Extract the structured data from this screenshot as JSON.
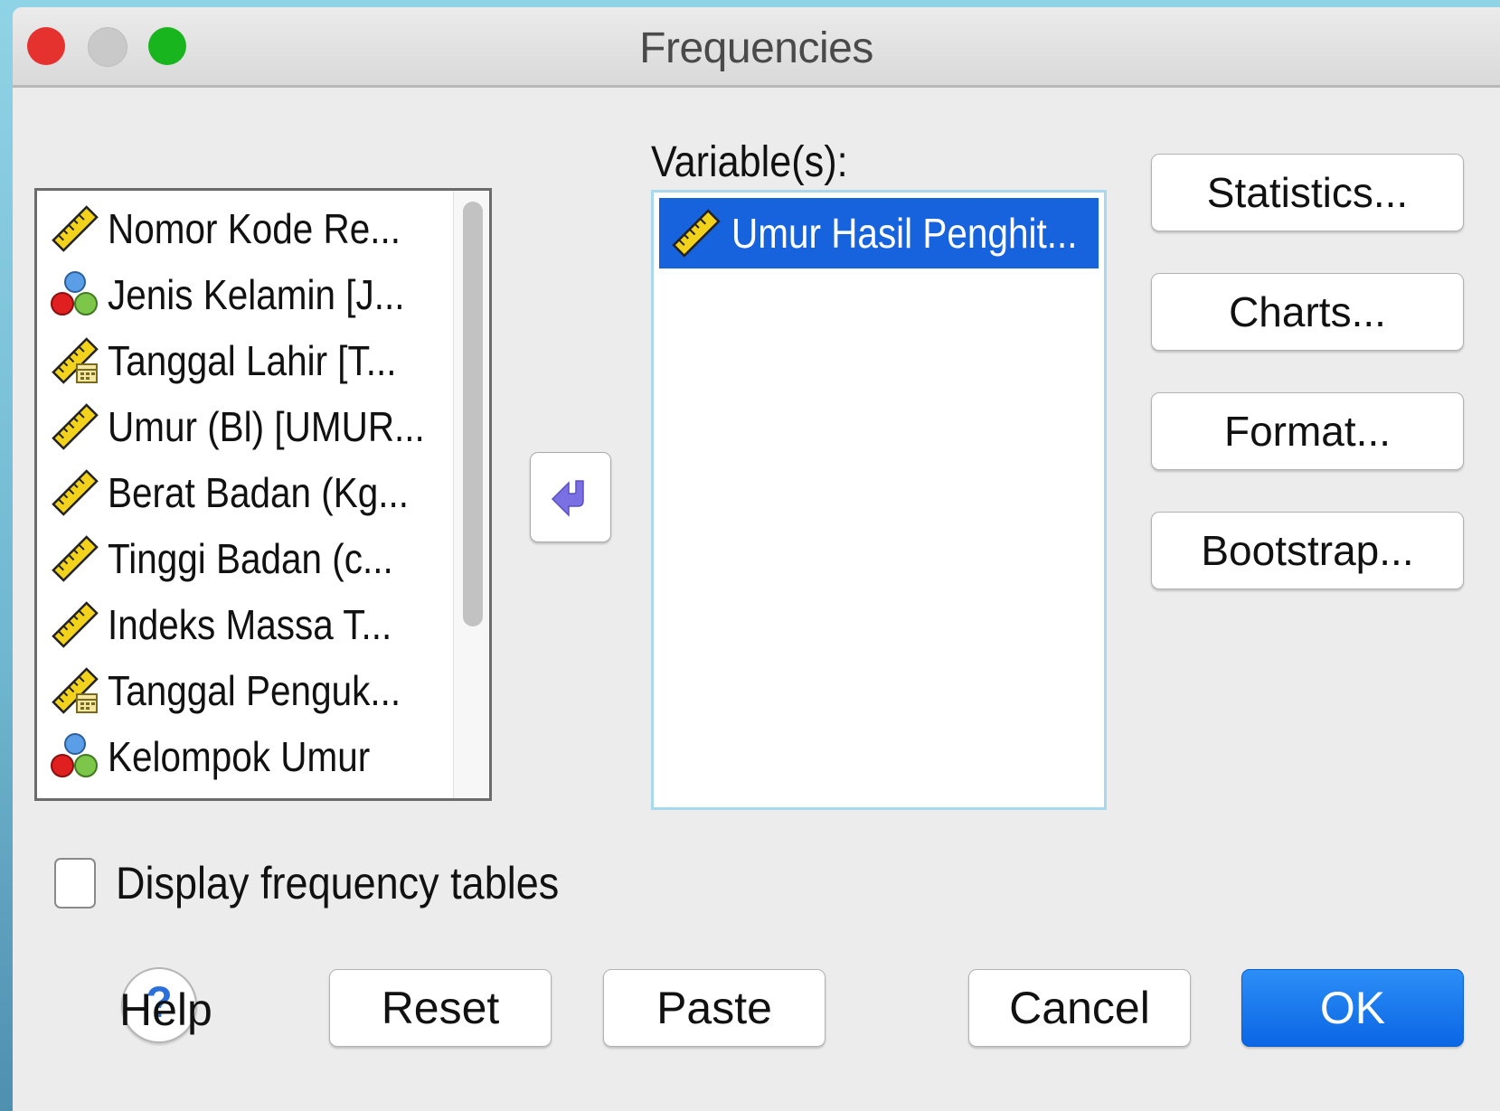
{
  "window": {
    "title": "Frequencies"
  },
  "source_list": {
    "items": [
      {
        "label": "Nomor Kode Re...",
        "icon": "scale-ruler-icon"
      },
      {
        "label": "Jenis Kelamin [J...",
        "icon": "nominal-icon"
      },
      {
        "label": "Tanggal Lahir [T...",
        "icon": "date-scale-icon"
      },
      {
        "label": "Umur (Bl) [UMUR...",
        "icon": "scale-ruler-icon"
      },
      {
        "label": "Berat Badan (Kg...",
        "icon": "scale-ruler-icon"
      },
      {
        "label": "Tinggi Badan (c...",
        "icon": "scale-ruler-icon"
      },
      {
        "label": "Indeks Massa T...",
        "icon": "scale-ruler-icon"
      },
      {
        "label": "Tanggal Penguk...",
        "icon": "date-scale-icon"
      },
      {
        "label": "Kelompok Umur",
        "icon": "nominal-icon"
      }
    ]
  },
  "move_button": {
    "icon": "arrow-left-icon"
  },
  "variables": {
    "label": "Variable(s):",
    "items": [
      {
        "label": "Umur Hasil Penghit...",
        "icon": "scale-ruler-icon",
        "selected": true
      }
    ]
  },
  "side_buttons": {
    "statistics": "Statistics...",
    "charts": "Charts...",
    "format": "Format...",
    "bootstrap": "Bootstrap..."
  },
  "display_frequency_tables": {
    "label": "Display frequency tables",
    "checked": false
  },
  "bottom_buttons": {
    "help": "Help",
    "reset": "Reset",
    "paste": "Paste",
    "cancel": "Cancel",
    "ok": "OK"
  },
  "colors": {
    "selection": "#1763de",
    "ok_button": "#0b66e4",
    "close": "#e5322e",
    "maximize": "#19b51e"
  }
}
